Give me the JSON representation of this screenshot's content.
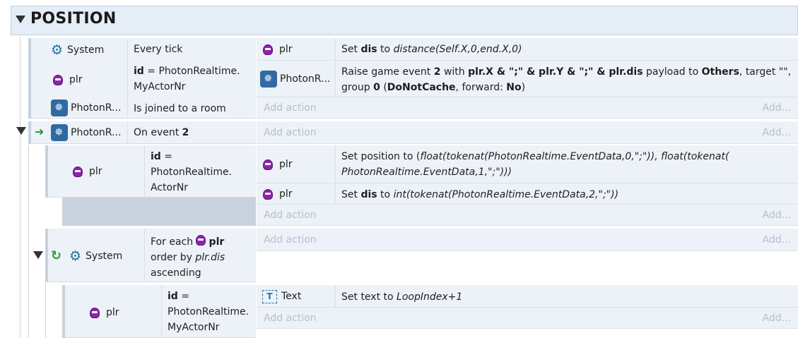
{
  "group": {
    "title": "POSITION"
  },
  "ev1": {
    "conds": [
      {
        "obj": "System",
        "text": "Every tick"
      },
      {
        "obj": "plr",
        "text_pre": "id",
        "text_post": " = PhotonRealtime.",
        "text_line2": "MyActorNr"
      },
      {
        "obj": "PhotonR...",
        "text": "Is joined to a room"
      }
    ],
    "actions": [
      {
        "obj": "plr",
        "t1": "Set ",
        "b1": "dis",
        "t2": " to ",
        "i1": "distance(Self.X,0,end.X,0)"
      },
      {
        "obj": "PhotonR...",
        "line1_pre": "Raise game event ",
        "line1_b1": "2",
        "line1_mid": " with ",
        "line1_b2": "plr.X & \";\" & plr.Y & \";\" & plr.dis",
        "line1_mid2": " payload to ",
        "line1_b3": "Others",
        "line1_post": ", target \"\",",
        "line2_pre": "group ",
        "line2_b1": "0",
        "line2_mid": " (",
        "line2_b2": "DoNotCache",
        "line2_mid2": ", forward: ",
        "line2_b3": "No",
        "line2_post": ")"
      }
    ],
    "add_action": "Add action",
    "add_short": "Add..."
  },
  "ev2": {
    "obj": "PhotonR...",
    "text_pre": "On event ",
    "text_b": "2",
    "add_action": "Add action",
    "add_short": "Add..."
  },
  "sub1": {
    "obj": "plr",
    "cond_b": "id",
    "cond_l1": " =",
    "cond_l2": "PhotonRealtime.",
    "cond_l3": "ActorNr",
    "actions": [
      {
        "obj": "plr",
        "t1": "Set position to (",
        "i1": "float(tokenat(PhotonRealtime.EventData,0,\";\")), float(tokenat(",
        "i2": "PhotonRealtime.EventData,1,\";\")))"
      },
      {
        "obj": "plr",
        "t1": "Set ",
        "b1": "dis",
        "t2": " to ",
        "i1": "int(tokenat(PhotonRealtime.EventData,2,\";\"))"
      }
    ],
    "add_action": "Add action",
    "add_short": "Add..."
  },
  "sub2": {
    "obj": "System",
    "t1": "For each ",
    "b1": "plr",
    "t2": "order by ",
    "i1": "plr.dis",
    "t3": "ascending",
    "add_action": "Add action",
    "add_short": "Add..."
  },
  "sub3": {
    "obj": "plr",
    "cond_b": "id",
    "cond_l1": " =",
    "cond_l2": "PhotonRealtime.",
    "cond_l3": "MyActorNr",
    "action": {
      "obj": "Text",
      "t1": "Set text to ",
      "i1": "LoopIndex+1"
    },
    "add_action": "Add action",
    "add_short": "Add..."
  },
  "icons": {
    "gear": "gear-icon",
    "photon": "photon-icon",
    "plr": "plr-sprite-icon",
    "text": "text-object-icon",
    "trigger": "trigger-arrow-icon",
    "loop": "loop-icon",
    "collapse": "collapse-triangle-icon"
  }
}
